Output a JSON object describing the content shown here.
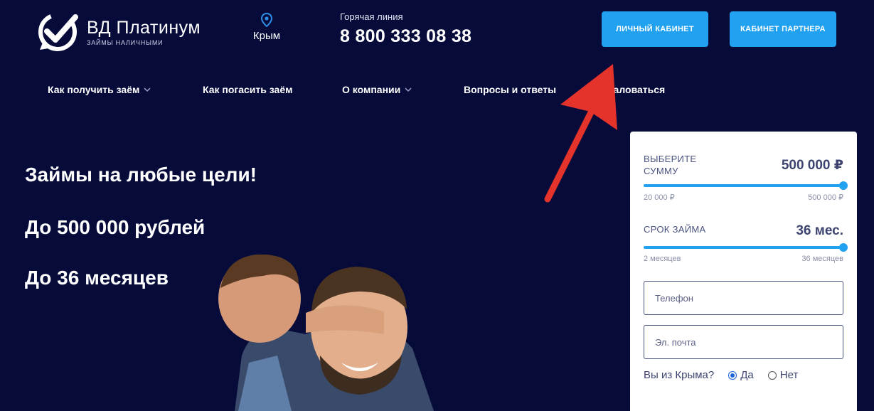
{
  "header": {
    "logo_title": "ВД Платинум",
    "logo_subtitle": "ЗАЙМЫ НАЛИЧНЫМИ",
    "region": "Крым",
    "hotline_label": "Горячая линия",
    "hotline_number": "8 800 333 08 38",
    "cabinet_button": "ЛИЧНЫЙ КАБИНЕТ",
    "partner_button": "КАБИНЕТ ПАРТНЕРА"
  },
  "nav": {
    "items": [
      {
        "label": "Как получить заём"
      },
      {
        "label": "Как погасить заём"
      },
      {
        "label": "О компании"
      },
      {
        "label": "Вопросы и ответы"
      },
      {
        "label": "Пожаловаться"
      }
    ]
  },
  "hero": {
    "line1": "Займы на любые цели!",
    "line2": "До 500 000 рублей",
    "line3": "До 36 месяцев"
  },
  "calculator": {
    "amount_label": "ВЫБЕРИТЕ СУММУ",
    "amount_value": "500 000 ₽",
    "amount_min": "20 000 ₽",
    "amount_max": "500 000 ₽",
    "amount_fraction": 1.0,
    "term_label": "СРОК ЗАЙМА",
    "term_value": "36 мес.",
    "term_min": "2 месяцев",
    "term_max": "36 месяцев",
    "term_fraction": 1.0,
    "phone_placeholder": "Телефон",
    "email_placeholder": "Эл. почта",
    "crimea_question": "Вы из Крыма?",
    "yes_label": "Да",
    "no_label": "Нет",
    "selected": "yes"
  },
  "colors": {
    "background": "#060b3a",
    "accent": "#22a1f0",
    "annotation_arrow": "#e4332b"
  }
}
